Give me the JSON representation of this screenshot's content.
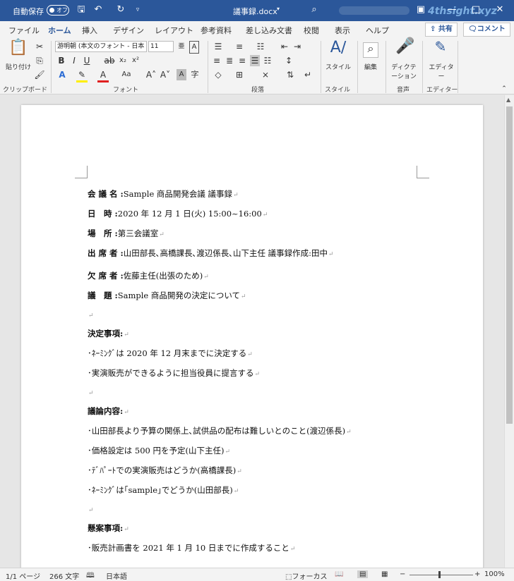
{
  "titlebar": {
    "autosave_label": "自動保存",
    "autosave_state": "オフ",
    "doc_title": "議事録.docx",
    "watermark": "4thsight.xyz"
  },
  "tabs": [
    "ファイル",
    "ホーム",
    "挿入",
    "デザイン",
    "レイアウト",
    "参考資料",
    "差し込み文書",
    "校閲",
    "表示",
    "ヘルプ"
  ],
  "share_label": "共有",
  "comment_label": "コメント",
  "ribbon": {
    "paste_label": "貼り付け",
    "clipboard_group": "クリップボード",
    "font_name": "游明朝 (本文のフォント - 日本",
    "font_size": "11",
    "font_group": "フォント",
    "paragraph_group": "段落",
    "style_label": "スタイル",
    "style_group": "スタイル",
    "edit_label": "編集",
    "dictate_label": "ディクテーション",
    "voice_group": "音声",
    "editor_label": "エディター",
    "editor_group": "エディター"
  },
  "document": {
    "lines": [
      {
        "label": "会 議 名 :",
        "text": "Sample 商品開発会議 議事録"
      },
      {
        "label": "日　時 :",
        "text": "2020 年 12 月 1 日(火) 15:00~16:00"
      },
      {
        "label": "場　所 :",
        "text": "第三会議室"
      },
      {
        "label": "出 席 者 :",
        "text": "山田部長､高橋課長､渡辺係長､山下主任 議事録作成:田中"
      },
      {
        "label": "欠 席 者 :",
        "text": "佐藤主任(出張のため)"
      },
      {
        "label": "議　題 :",
        "text": "Sample 商品開発の決定について"
      },
      {
        "label": "",
        "text": ""
      },
      {
        "label": "決定事項:",
        "text": ""
      },
      {
        "label": "",
        "text": "･ﾈｰﾐﾝｸﾞは 2020 年 12 月末までに決定する"
      },
      {
        "label": "",
        "text": "･実演販売ができるように担当役員に提言する"
      },
      {
        "label": "",
        "text": ""
      },
      {
        "label": "議論内容:",
        "text": ""
      },
      {
        "label": "",
        "text": "･山田部長より予算の関係上､試供品の配布は難しいとのこと(渡辺係長)"
      },
      {
        "label": "",
        "text": "･価格設定は 500 円を予定(山下主任)"
      },
      {
        "label": "",
        "text": "･ﾃﾞﾊﾟｰﾄでの実演販売はどうか(高橋課長)"
      },
      {
        "label": "",
        "text": "･ﾈｰﾐﾝｸﾞは｢sample｣でどうか(山田部長)"
      },
      {
        "label": "",
        "text": ""
      },
      {
        "label": "懸案事項:",
        "text": ""
      },
      {
        "label": "",
        "text": "･販売計画書を 2021 年 1 月 10 日までに作成すること"
      }
    ]
  },
  "status": {
    "page": "1/1 ページ",
    "words": "266 文字",
    "language": "日本語",
    "focus": "フォーカス",
    "zoom": "100%"
  }
}
